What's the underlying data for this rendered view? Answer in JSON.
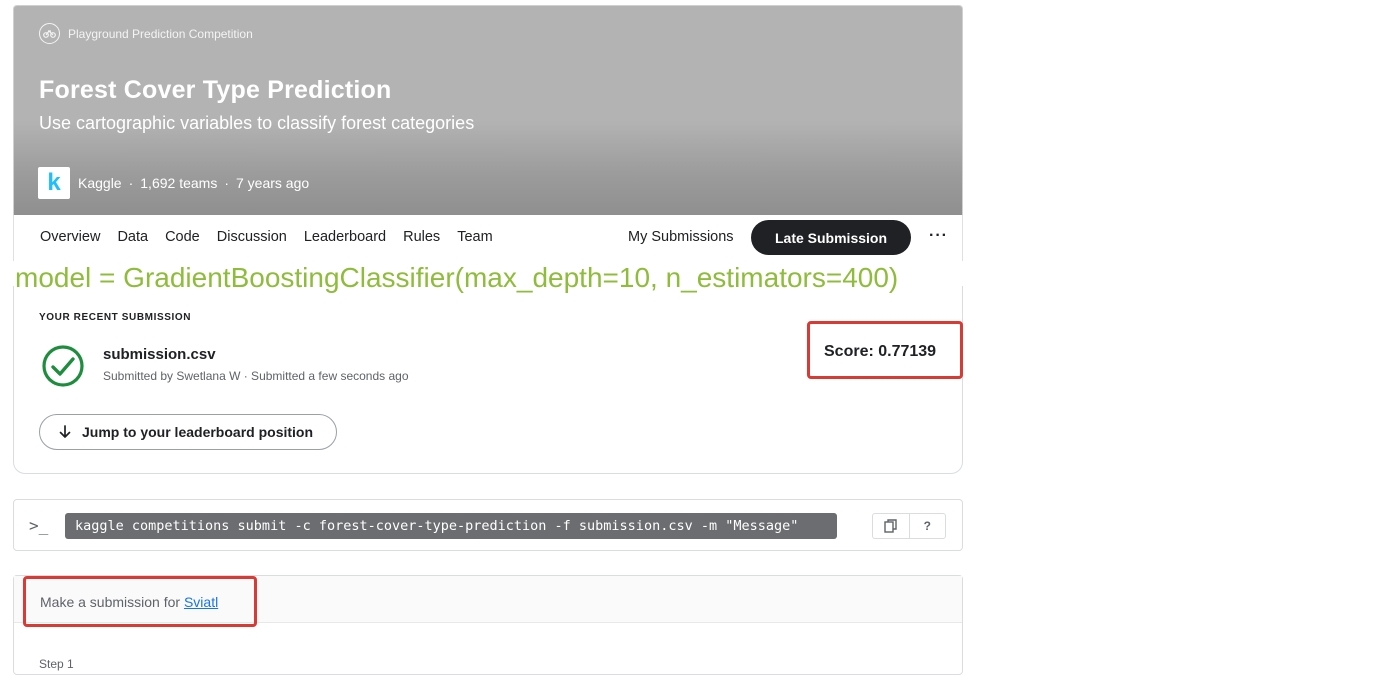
{
  "header": {
    "kind": "Playground Prediction Competition",
    "title": "Forest Cover Type Prediction",
    "subtitle": "Use cartographic variables to classify forest categories",
    "host_logo_letter": "k",
    "host": "Kaggle",
    "teams": "1,692 teams",
    "age": "7 years ago"
  },
  "nav": {
    "tabs": [
      "Overview",
      "Data",
      "Code",
      "Discussion",
      "Leaderboard",
      "Rules",
      "Team"
    ],
    "my_submissions": "My Submissions",
    "late_submission": "Late Submission",
    "more": "···"
  },
  "annotation": "model = GradientBoostingClassifier(max_depth=10, n_estimators=400)",
  "recent": {
    "label": "YOUR RECENT SUBMISSION",
    "file_name": "submission.csv",
    "submitted": "Submitted by Swetlana W · Submitted a few seconds ago",
    "score": "Score: 0.77139",
    "jump_label": "Jump to your leaderboard position"
  },
  "cli": {
    "prompt": ">_",
    "command": "kaggle competitions submit -c forest-cover-type-prediction -f submission.csv -m \"Message\"",
    "help": "?"
  },
  "make": {
    "text": "Make a submission for ",
    "link": "Sviatl",
    "step": "Step 1"
  },
  "colors": {
    "annotation": "#8fbc3a",
    "highlight_box": "#d93a34",
    "check": "#1e8e3e",
    "link": "#1a73e8"
  }
}
